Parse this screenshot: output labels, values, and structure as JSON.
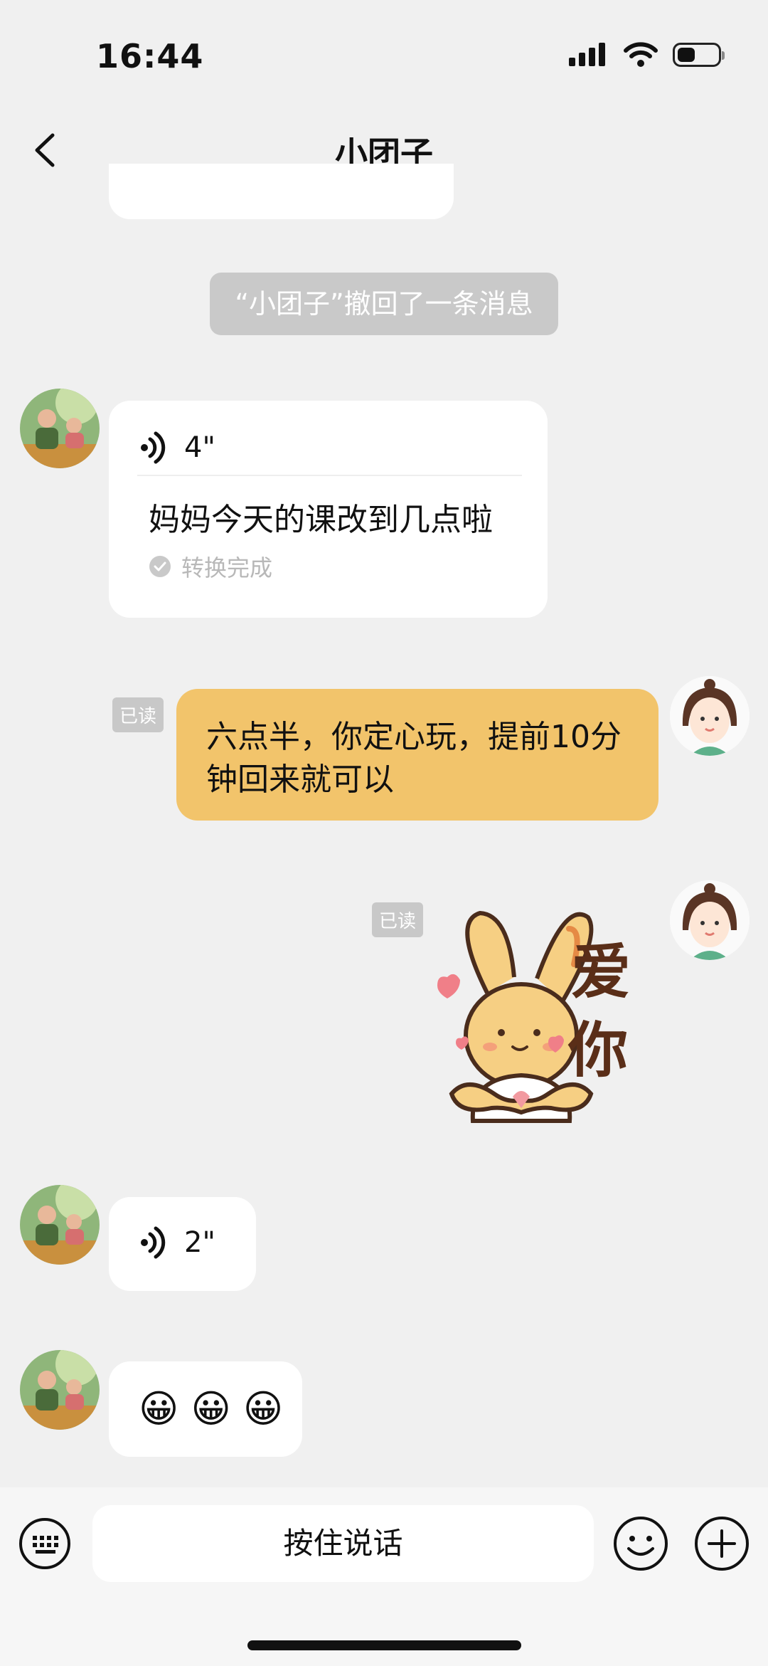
{
  "status_bar": {
    "time": "16:44"
  },
  "nav": {
    "title": "小团子"
  },
  "system_message": "“小团子”撤回了一条消息",
  "messages": {
    "voice1": {
      "duration": "4\"",
      "transcript": "妈妈今天的课改到几点啦",
      "status": "转换完成"
    },
    "reply_text": {
      "read_label": "已读",
      "text_line1": "六点半，你定心玩，提前10分",
      "text_line2": "钟回来就可以"
    },
    "sticker": {
      "read_label": "已读",
      "text_line1": "爱",
      "text_line2": "你"
    },
    "voice2": {
      "duration": "2\""
    },
    "emoji_msg": {
      "emojis": "😀 😀 😀"
    }
  },
  "input_bar": {
    "hold_to_talk": "按住说话"
  },
  "colors": {
    "background": "#f0f0f0",
    "sent_bubble": "#f2c46b",
    "received_bubble": "#ffffff"
  }
}
